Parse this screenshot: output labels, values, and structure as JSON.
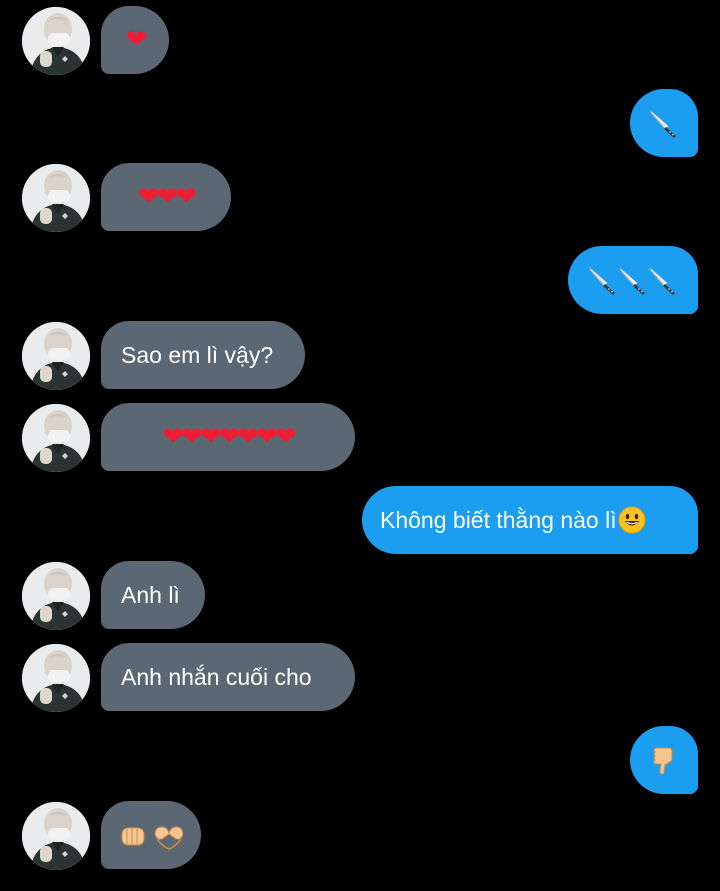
{
  "messages": [
    {
      "side": "in",
      "kind": "hearts",
      "count": 1
    },
    {
      "side": "out",
      "kind": "knives",
      "count": 1
    },
    {
      "side": "in",
      "kind": "hearts",
      "count": 3
    },
    {
      "side": "out",
      "kind": "knives",
      "count": 3
    },
    {
      "side": "in",
      "kind": "text",
      "text": "Sao em lì vậy?"
    },
    {
      "side": "in",
      "kind": "hearts",
      "count": 7
    },
    {
      "side": "out",
      "kind": "text",
      "text": "Không biết thằng nào lì",
      "trailing_emoji": "grinning-face-icon"
    },
    {
      "side": "in",
      "kind": "text",
      "text": "Anh lì"
    },
    {
      "side": "in",
      "kind": "text",
      "text": "Anh nhắn cuối cho"
    },
    {
      "side": "out",
      "kind": "emoji",
      "emoji": "thumbs-down-icon"
    },
    {
      "side": "in",
      "kind": "emoji",
      "emoji": "fist-and-heart-hands-icon"
    }
  ],
  "text": {
    "m5": "Sao em lì vậy?",
    "m7": "Không biết thằng nào lì",
    "m8": "Anh lì",
    "m9": "Anh nhắn cuối cho"
  },
  "glyphs": {
    "heart": "❤",
    "hearts_1": "❤",
    "hearts_3": "❤❤❤",
    "hearts_7": "❤❤❤❤❤❤❤"
  },
  "colors": {
    "background": "#000000",
    "incoming_bubble": "#5b6874",
    "outgoing_bubble": "#1b9df0",
    "text": "#ffffff",
    "heart": "#ee1d32"
  }
}
